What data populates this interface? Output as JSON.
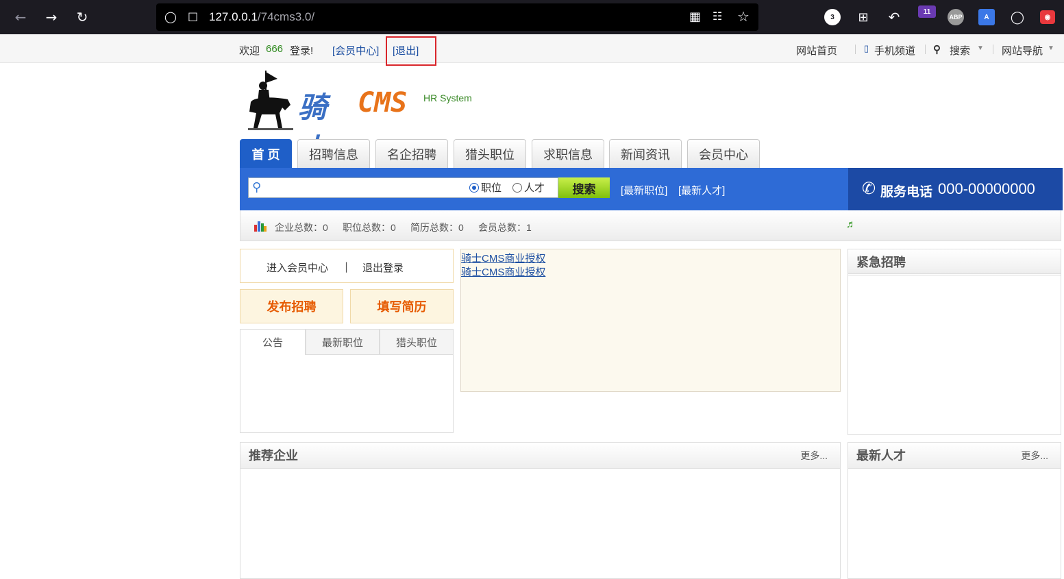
{
  "browser": {
    "url_host": "127.0.0.1",
    "url_path": "/74cms3.0/",
    "tab_count": "3",
    "ext_badge": "11"
  },
  "topbar": {
    "welcome": "欢迎",
    "username": "666",
    "logged_in": "登录!",
    "member_center": "[会员中心]",
    "logout": "[退出]",
    "home": "网站首页",
    "mobile": "手机频道",
    "search": "搜索",
    "nav": "网站导航"
  },
  "logo": {
    "name": "骑士",
    "cms": "CMS",
    "subtitle": "HR System"
  },
  "tabs": [
    "首 页",
    "招聘信息",
    "名企招聘",
    "猎头职位",
    "求职信息",
    "新闻资讯",
    "会员中心"
  ],
  "search": {
    "radio_job": "职位",
    "radio_talent": "人才",
    "button": "搜索",
    "link_jobs": "[最新职位]",
    "link_talent": "[最新人才]"
  },
  "phone": {
    "label": "服务电话",
    "number": "000-00000000"
  },
  "stats": {
    "companies": "企业总数：0",
    "jobs": "职位总数：0",
    "resumes": "简历总数：0",
    "members": "会员总数：1"
  },
  "member_box": {
    "enter": "进入会员中心",
    "divider": "|",
    "logout": "退出登录"
  },
  "buttons": {
    "publish": "发布招聘",
    "resume": "填写简历"
  },
  "subtabs": [
    "公告",
    "最新职位",
    "猎头职位"
  ],
  "notice_links": [
    "骑士CMS商业授权",
    "骑士CMS商业授权"
  ],
  "urgent": {
    "title": "紧急招聘"
  },
  "recommended": {
    "title": "推荐企业",
    "more": "更多..."
  },
  "talent": {
    "title": "最新人才",
    "more": "更多..."
  },
  "colors": {
    "primary": "#2e6bd6",
    "accent": "#e65a00",
    "highlight": "#d9252b"
  }
}
